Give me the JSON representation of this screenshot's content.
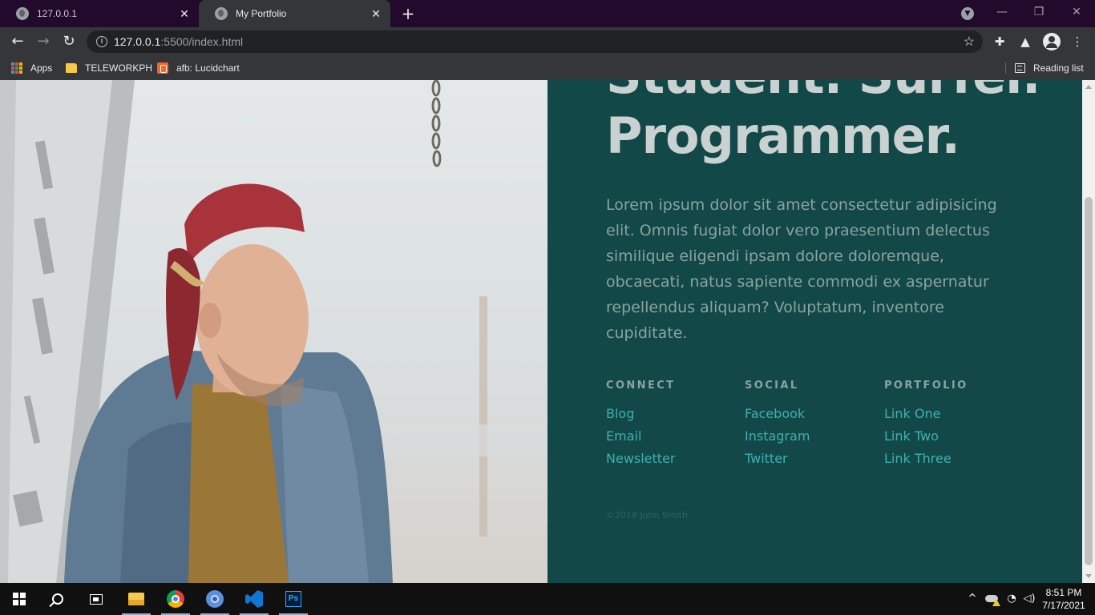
{
  "browser": {
    "tabs": [
      {
        "title": "127.0.0.1",
        "active": false
      },
      {
        "title": "My Portfolio",
        "active": true
      }
    ],
    "url_host": "127.0.0.1",
    "url_rest": ":5500/index.html",
    "bookmarks": [
      {
        "label": "Apps",
        "icon": "apps-grid-icon"
      },
      {
        "label": "TELEWORKPH",
        "icon": "folder-icon"
      },
      {
        "label": "afb: Lucidchart",
        "icon": "lucidchart-icon"
      }
    ],
    "reading_list": "Reading list"
  },
  "page": {
    "hero_line1": "Student. Surfer.",
    "hero_line2": "Programmer.",
    "intro": "Lorem ipsum dolor sit amet consectetur adipisicing elit. Omnis fugiat dolor vero praesentium delectus similique eligendi ipsam dolore doloremque, obcaecati, natus sapiente commodi ex aspernatur repellendus aliquam? Voluptatum, inventore cupiditate.",
    "columns": [
      {
        "heading": "CONNECT",
        "links": [
          "Blog",
          "Email",
          "Newsletter"
        ]
      },
      {
        "heading": "SOCIAL",
        "links": [
          "Facebook",
          "Instagram",
          "Twitter"
        ]
      },
      {
        "heading": "PORTFOLIO",
        "links": [
          "Link One",
          "Link Two",
          "Link Three"
        ]
      }
    ],
    "copyright": "©2018 John Smith",
    "colors": {
      "panel_bg": "#124847",
      "link": "#3fb0b0",
      "heading": "#c9d1d1",
      "body_text": "#8aa3a2"
    }
  },
  "taskbar": {
    "apps": [
      "windows-start-icon",
      "search-icon",
      "task-view-icon",
      "file-explorer-icon",
      "chrome-icon",
      "chrome-profile-icon",
      "vscode-icon",
      "photoshop-icon"
    ],
    "photoshop_label": "Ps",
    "time": "8:51 PM",
    "date": "7/17/2021"
  }
}
